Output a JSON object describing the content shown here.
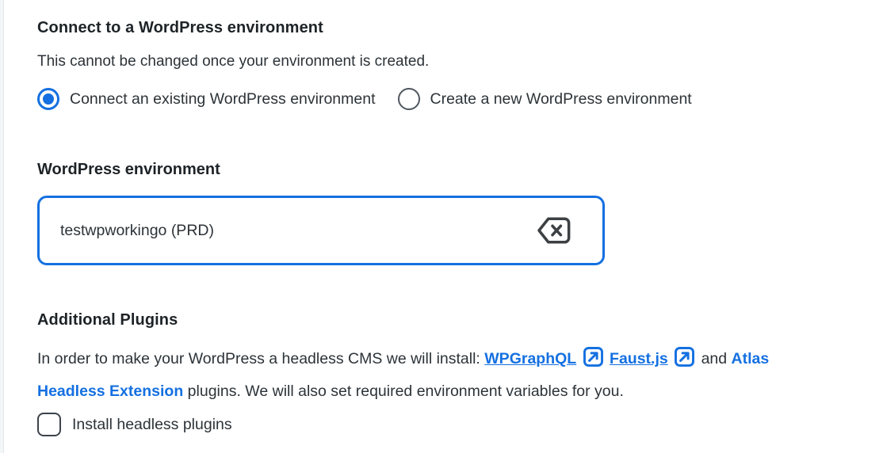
{
  "colors": {
    "accent_blue": "#1470e1",
    "heading_text": "#1d2327",
    "body_text": "#2c3338"
  },
  "connect_section": {
    "heading": "Connect to a WordPress environment",
    "description": "This cannot be changed once your environment is created.",
    "radio_group": {
      "options": [
        {
          "label": "Connect an existing WordPress environment",
          "selected": true
        },
        {
          "label": "Create a new WordPress environment",
          "selected": false
        }
      ]
    }
  },
  "environment_field": {
    "label": "WordPress environment",
    "value": "testwpworkingo (PRD)",
    "clear_icon": "backspace-clear-icon"
  },
  "plugins_section": {
    "heading": "Additional Plugins",
    "paragraph": {
      "intro": "In order to make your WordPress a headless CMS we will install:",
      "link_wpgraphql": "WPGraphQL",
      "link_faustjs": "Faust.js",
      "conjunction": "and",
      "link_atlas": "Atlas Headless Extension",
      "outro": "plugins. We will also set required environment variables for you."
    },
    "external_link_icon": "external-link-icon",
    "checkbox": {
      "label": "Install headless plugins",
      "checked": false
    }
  }
}
